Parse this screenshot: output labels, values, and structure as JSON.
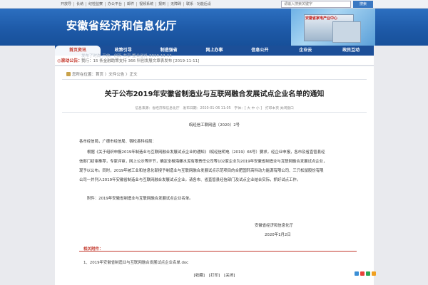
{
  "topbar": {
    "links": [
      "开放导",
      "长纳",
      "纪检监察",
      "办公平台",
      "邮件",
      "视频系统",
      "报到",
      "无障碍",
      "联系 · 功能后设"
    ],
    "search_placeholder": "请输入搜索关键字",
    "search_button": "搜索"
  },
  "banner": {
    "title": "安徽省经济和信息化厅",
    "sign_text": "安徽省家电产业中心"
  },
  "nav": {
    "items": [
      "首页资讯",
      "政策引导",
      "制造强省",
      "网上办事",
      "信息公开",
      "企业云",
      "政民互动"
    ],
    "active_index": 0
  },
  "notice": {
    "label": "◎滚动公告：",
    "ghost_text": "发布了时尚·开放、创新·共享 整合省外 2019-11-11",
    "item": "我行：15 条金融助策支持 366 科创发展文章表发布 [2019-11-11]"
  },
  "breadcrumb": {
    "prefix": "您所在位置：",
    "items": [
      "首页",
      "文件公告",
      "正文"
    ],
    "sep": " 〉"
  },
  "article": {
    "title": "关于公布2019年安徽省制造业与互联网融合发展试点企业名单的通知",
    "meta": "信息来源：省经济和信息化厅　发布日期：2020-01-06 11:05　字体：[ 大 中 小 ]　打印本页 关闭窗口",
    "doc_number": "皖经信工联网函〔2020〕2号",
    "recipients": "各市经信局，广德市经信局、宿松县科经局：",
    "body_lines": [
      "根据《关于组织申报2019年制造业与互联网融合发展试点企业的通知》（皖经信明电〔2019〕66号）要求，经企业申报，各市及省直管县经",
      "信部门初审推荐，专家评审，网上公示等环节，确定全椒海螺水泥有限责任公司等102家企业为2019年安徽省制造业与互联网融合发展试点企业，",
      "现予以公布。同时，2019年被工业和信息化部授予制造业与互联网融合发展试点示范项目的合肥国轩高科动力能源有限公司、三只松鼠股份有限",
      "公司一并列入2019年安徽省制造业与互联网融合发展试点企业。请各市、省直管县经信部门及试点企业结合实际，抓好试点工作。"
    ],
    "attachment_note": "附件：2019年安徽省制造业与互联网融合发展试点企业名单。",
    "signature": "安徽省经济和信息化厅",
    "date": "2020年1月2日"
  },
  "attachments": {
    "heading": "相关附件：",
    "files": [
      "1、2019年安徽省制造业与互联网融合发展试点企业名单.doc"
    ]
  },
  "footer": {
    "buttons": [
      "[收藏]",
      "[打印]",
      "[关闭]"
    ]
  },
  "share_colors": [
    "#3b8fd6",
    "#e8423a",
    "#2aa654",
    "#f0a020",
    "#7a5bd0"
  ]
}
